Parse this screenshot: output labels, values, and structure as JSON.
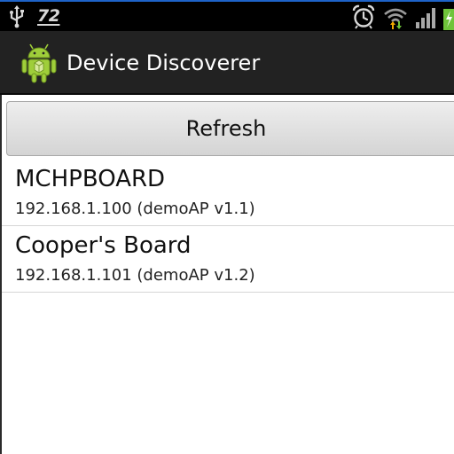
{
  "status_bar": {
    "battery_level": "72",
    "icons": [
      "usb-icon",
      "alarm-icon",
      "wifi-icon",
      "signal-icon",
      "charging-icon"
    ]
  },
  "action_bar": {
    "title": "Device Discoverer",
    "icon": "android-icon"
  },
  "toolbar": {
    "refresh_label": "Refresh"
  },
  "devices": [
    {
      "name": "MCHPBOARD",
      "detail": "192.168.1.100 (demoAP v1.1)"
    },
    {
      "name": "Cooper's Board",
      "detail": "192.168.1.101 (demoAP v1.2)"
    }
  ],
  "colors": {
    "status_bar": "#000000",
    "status_bar_top_accent": "#1e63c8",
    "action_bar": "#222222",
    "android_green": "#9fce3a",
    "wifi_arrows": "#f2a900",
    "battery_charge": "#6fc43a"
  }
}
